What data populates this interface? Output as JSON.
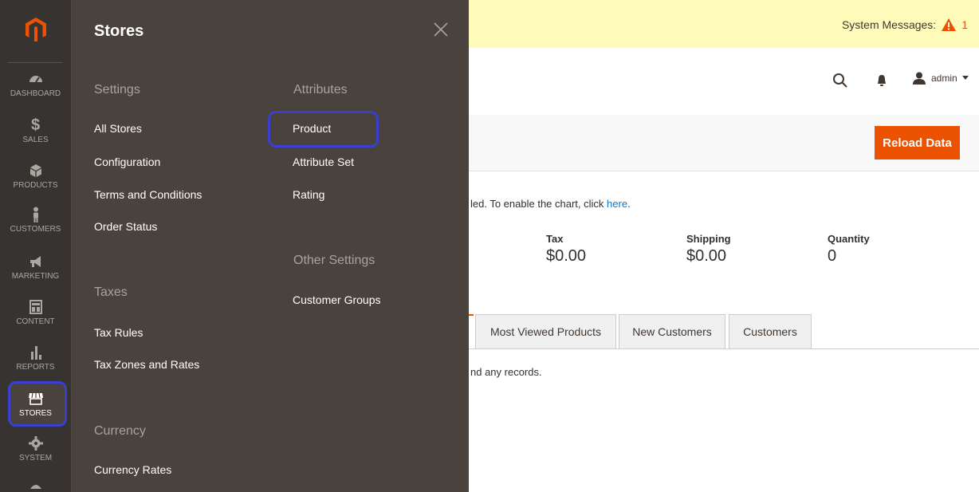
{
  "nav": {
    "items": [
      {
        "id": "dashboard",
        "label": "DASHBOARD",
        "icon": "speedometer-icon"
      },
      {
        "id": "sales",
        "label": "SALES",
        "icon": "dollar-icon"
      },
      {
        "id": "products",
        "label": "PRODUCTS",
        "icon": "cube-icon"
      },
      {
        "id": "customers",
        "label": "CUSTOMERS",
        "icon": "person-icon"
      },
      {
        "id": "marketing",
        "label": "MARKETING",
        "icon": "megaphone-icon"
      },
      {
        "id": "content",
        "label": "CONTENT",
        "icon": "layout-icon"
      },
      {
        "id": "reports",
        "label": "REPORTS",
        "icon": "bar-chart-icon"
      },
      {
        "id": "stores",
        "label": "STORES",
        "icon": "storefront-icon"
      },
      {
        "id": "system",
        "label": "SYSTEM",
        "icon": "gear-icon"
      }
    ],
    "active": "stores"
  },
  "panel": {
    "title": "Stores",
    "sections": {
      "settings": {
        "title": "Settings",
        "links": [
          "All Stores",
          "Configuration",
          "Terms and Conditions",
          "Order Status"
        ]
      },
      "taxes": {
        "title": "Taxes",
        "links": [
          "Tax Rules",
          "Tax Zones and Rates"
        ]
      },
      "currency": {
        "title": "Currency",
        "links": [
          "Currency Rates"
        ]
      },
      "attributes": {
        "title": "Attributes",
        "links": [
          "Product",
          "Attribute Set",
          "Rating"
        ]
      },
      "other": {
        "title": "Other Settings",
        "links": [
          "Customer Groups"
        ]
      }
    }
  },
  "system_messages": {
    "label": "System Messages:",
    "count": "1"
  },
  "header": {
    "user": "admin"
  },
  "actions": {
    "reload": "Reload Data"
  },
  "dashboard": {
    "chart_note_prefix": "led. To enable the chart, click ",
    "chart_note_link": "here",
    "chart_note_suffix": ".",
    "stats": [
      {
        "label": "Tax",
        "value": "$0.00"
      },
      {
        "label": "Shipping",
        "value": "$0.00"
      },
      {
        "label": "Quantity",
        "value": "0"
      }
    ],
    "tabs": [
      "Most Viewed Products",
      "New Customers",
      "Customers"
    ],
    "no_records": "nd any records."
  },
  "colors": {
    "accent": "#eb5202",
    "highlight": "#3b3fd1",
    "panel": "#4a423c",
    "rail": "#373330"
  }
}
